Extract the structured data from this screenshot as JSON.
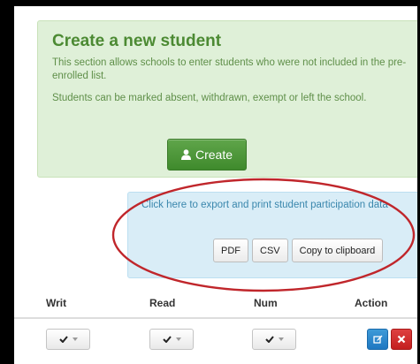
{
  "create_section": {
    "title": "Create a new student",
    "description_1": "This section allows schools to enter students who were not included in the pre-enrolled list.",
    "description_2": "Students can be marked absent, withdrawn, exempt or left the school.",
    "create_button_label": "Create",
    "create_button_icon": "user-icon"
  },
  "export_section": {
    "link_text": "Click here to export and print student participation data",
    "buttons": {
      "pdf": "PDF",
      "csv": "CSV",
      "clipboard": "Copy to clipboard"
    }
  },
  "table": {
    "headers": {
      "writ": "Writ",
      "read": "Read",
      "num": "Num",
      "action": "Action"
    }
  },
  "colors": {
    "success_panel": "#dff0d8",
    "info_panel": "#d9edf7",
    "primary_green": "#4c8a33",
    "annotation_red": "#c0262b",
    "edit_blue": "#2b87cc",
    "delete_red": "#d32f2f"
  }
}
